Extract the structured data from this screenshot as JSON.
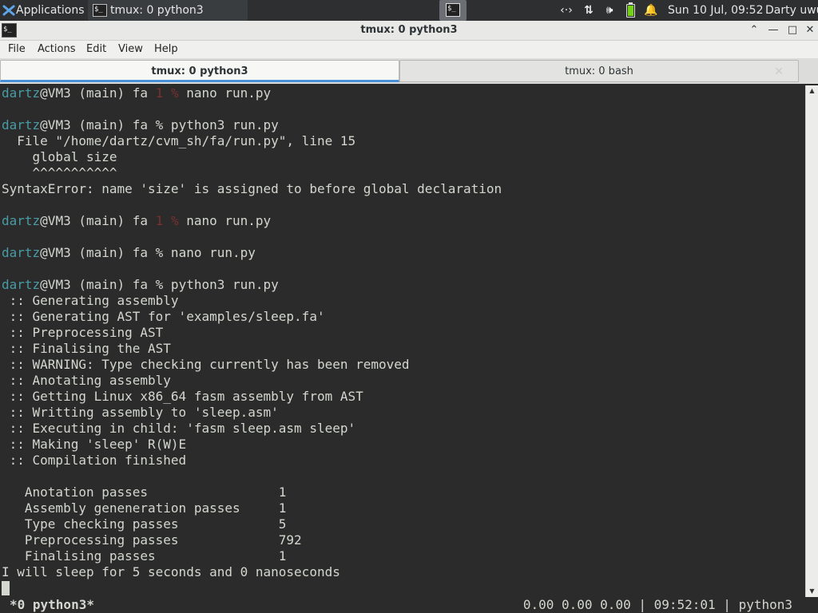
{
  "panel": {
    "apps_label": "Applications",
    "task_label": "tmux: 0 python3",
    "clock": "Sun 10 Jul, 09:52",
    "user": "Darty uwu",
    "icons": {
      "apps": "xfce-logo-icon",
      "network": "network-icon",
      "updown": "transfer-icon",
      "volume": "volume-icon",
      "battery": "battery-icon",
      "notifications": "bell-icon"
    },
    "battery_level": 0.85,
    "accent": "#73d216"
  },
  "window": {
    "title": "tmux: 0 python3"
  },
  "menubar": {
    "file": "File",
    "actions": "Actions",
    "edit": "Edit",
    "view": "View",
    "help": "Help"
  },
  "tabs": [
    {
      "label": "tmux: 0 python3"
    },
    {
      "label": "tmux: 0 bash"
    }
  ],
  "terminal": {
    "lines": [
      [
        [
          "dartz",
          "puser"
        ],
        [
          "@VM3 (main) fa ",
          ""
        ],
        [
          "1",
          "pdim"
        ],
        [
          " ",
          ""
        ],
        [
          "%",
          "pdim"
        ],
        [
          " nano run.py",
          ""
        ]
      ],
      [],
      [
        [
          "dartz",
          "puser"
        ],
        [
          "@VM3 (main) fa % python3 run.py",
          ""
        ]
      ],
      [
        [
          "  File \"/home/dartz/cvm_sh/fa/run.py\", line 15",
          ""
        ]
      ],
      [
        [
          "    global size",
          ""
        ]
      ],
      [
        [
          "    ^^^^^^^^^^^",
          ""
        ]
      ],
      [
        [
          "SyntaxError: name 'size' is assigned to before global declaration",
          ""
        ]
      ],
      [],
      [
        [
          "dartz",
          "puser"
        ],
        [
          "@VM3 (main) fa ",
          ""
        ],
        [
          "1",
          "pdim"
        ],
        [
          " ",
          ""
        ],
        [
          "%",
          "pdim"
        ],
        [
          " nano run.py",
          ""
        ]
      ],
      [],
      [
        [
          "dartz",
          "puser"
        ],
        [
          "@VM3 (main) fa % nano run.py",
          ""
        ]
      ],
      [],
      [
        [
          "dartz",
          "puser"
        ],
        [
          "@VM3 (main) fa % python3 run.py",
          ""
        ]
      ],
      [
        [
          " :: Generating assembly",
          ""
        ]
      ],
      [
        [
          " :: Generating AST for 'examples/sleep.fa'",
          ""
        ]
      ],
      [
        [
          " :: Preprocessing AST",
          ""
        ]
      ],
      [
        [
          " :: Finalising the AST",
          ""
        ]
      ],
      [
        [
          " :: WARNING: Type checking currently has been removed",
          ""
        ]
      ],
      [
        [
          " :: Anotating assembly",
          ""
        ]
      ],
      [
        [
          " :: Getting Linux x86_64 fasm assembly from AST",
          ""
        ]
      ],
      [
        [
          " :: Writting assembly to 'sleep.asm'",
          ""
        ]
      ],
      [
        [
          " :: Executing in child: 'fasm sleep.asm sleep'",
          ""
        ]
      ],
      [
        [
          " :: Making 'sleep' R(W)E",
          ""
        ]
      ],
      [
        [
          " :: Compilation finished",
          ""
        ]
      ],
      [],
      [
        [
          "   Anotation passes                 1",
          ""
        ]
      ],
      [
        [
          "   Assembly geneneration passes     1",
          ""
        ]
      ],
      [
        [
          "   Type checking passes             5",
          ""
        ]
      ],
      [
        [
          "   Preprocessing passes             792",
          ""
        ]
      ],
      [
        [
          "   Finalising passes                1",
          ""
        ]
      ],
      [
        [
          "I will sleep for 5 seconds and 0 nanoseconds",
          ""
        ]
      ]
    ]
  },
  "status": {
    "left": "*0 python3*",
    "right": "0.00 0.00 0.00 | 09:52:01 | python3"
  }
}
